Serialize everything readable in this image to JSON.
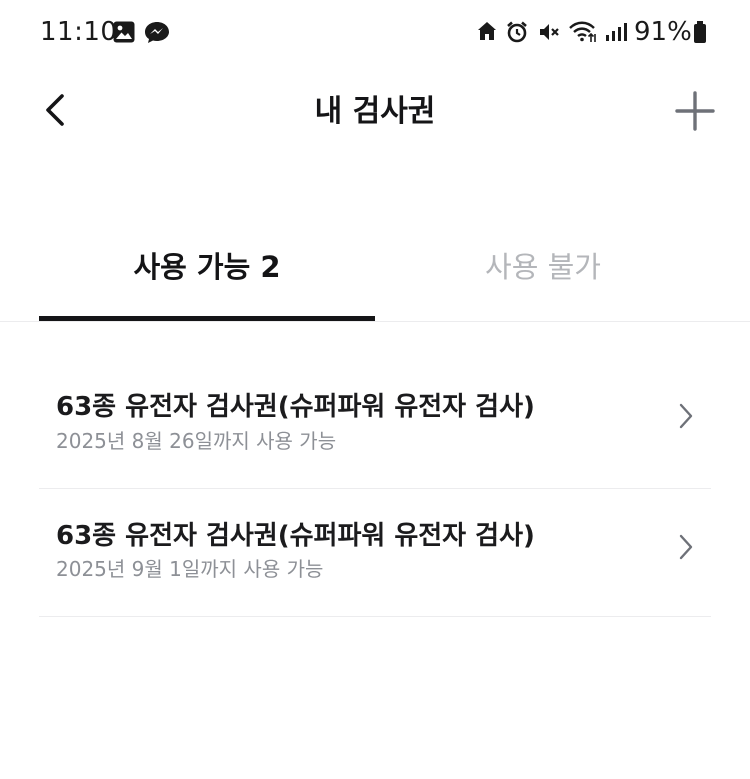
{
  "status_bar": {
    "time": "11:10",
    "battery": "91%",
    "left_icons": [
      "gallery-icon",
      "messenger-icon"
    ],
    "right_icons": [
      "home-icon",
      "alarm-icon",
      "mute-icon",
      "wifi-icon",
      "signal-icon",
      "battery-icon"
    ]
  },
  "header": {
    "title": "내 검사권",
    "back_icon": "chevron-left-icon",
    "add_icon": "plus-icon"
  },
  "tabs": [
    {
      "label": "사용 가능 2",
      "active": true
    },
    {
      "label": "사용 불가",
      "active": false
    }
  ],
  "tickets": [
    {
      "title": "63종 유전자 검사권(슈퍼파워 유전자 검사)",
      "subtitle": "2025년 8월 26일까지 사용 가능"
    },
    {
      "title": "63종 유전자 검사권(슈퍼파워 유전자 검사)",
      "subtitle": "2025년 9월 1일까지 사용 가능"
    }
  ],
  "colors": {
    "text_primary": "#151517",
    "text_inactive": "#b4b6ba",
    "text_secondary": "#8d9096",
    "divider": "#ececee"
  }
}
